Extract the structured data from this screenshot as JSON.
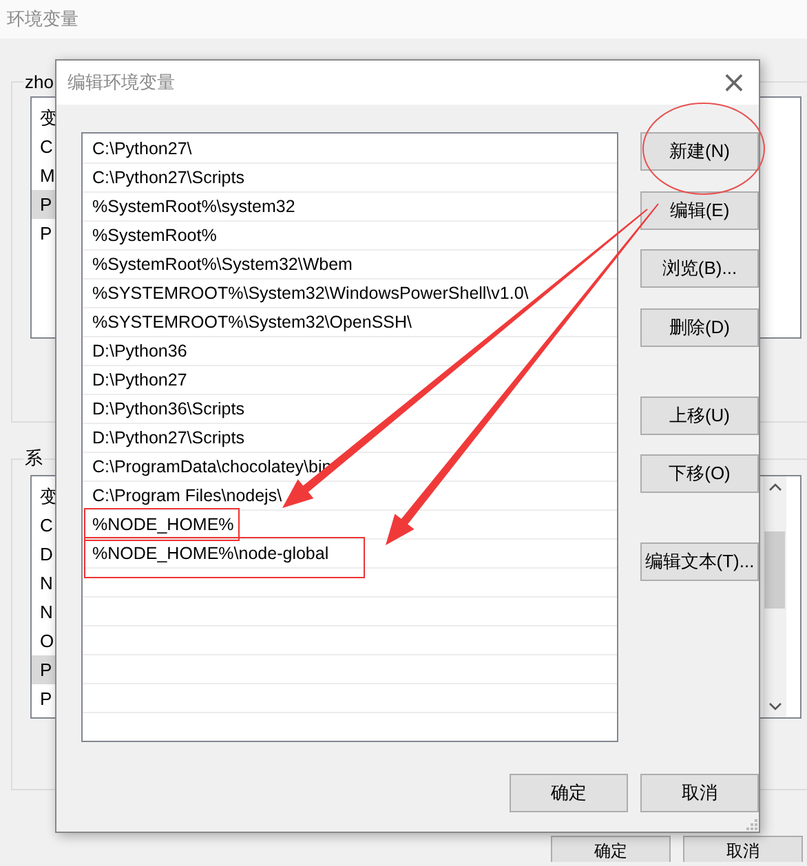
{
  "window": {
    "title": "环境变量"
  },
  "user_variables": {
    "legend": "zho",
    "header": "变",
    "rows": [
      {
        "name": "C",
        "selected": false
      },
      {
        "name": "M",
        "selected": false
      },
      {
        "name": "P",
        "selected": true
      },
      {
        "name": "P",
        "selected": false
      }
    ]
  },
  "system_variables": {
    "legend": "系",
    "header": "变",
    "rows": [
      {
        "name": "C",
        "selected": false
      },
      {
        "name": "D",
        "selected": false
      },
      {
        "name": "N",
        "selected": false
      },
      {
        "name": "N",
        "selected": false
      },
      {
        "name": "O",
        "selected": false
      },
      {
        "name": "P",
        "selected": true
      },
      {
        "name": "P",
        "selected": false
      }
    ]
  },
  "buttons": [
    "确定",
    "取消"
  ],
  "dialog": {
    "title": "编辑环境变量",
    "close": "×",
    "paths": [
      {
        "text": "C:\\Python27\\",
        "highlighted": false
      },
      {
        "text": "C:\\Python27\\Scripts",
        "highlighted": false
      },
      {
        "text": "%SystemRoot%\\system32",
        "highlighted": false
      },
      {
        "text": "%SystemRoot%",
        "highlighted": false
      },
      {
        "text": "%SystemRoot%\\System32\\Wbem",
        "highlighted": false
      },
      {
        "text": "%SYSTEMROOT%\\System32\\WindowsPowerShell\\v1.0\\",
        "highlighted": false
      },
      {
        "text": "%SYSTEMROOT%\\System32\\OpenSSH\\",
        "highlighted": false
      },
      {
        "text": "D:\\Python36",
        "highlighted": false
      },
      {
        "text": "D:\\Python27",
        "highlighted": false
      },
      {
        "text": "D:\\Python36\\Scripts",
        "highlighted": false
      },
      {
        "text": "D:\\Python27\\Scripts",
        "highlighted": false
      },
      {
        "text": "C:\\ProgramData\\chocolatey\\bin",
        "highlighted": false
      },
      {
        "text": "C:\\Program Files\\nodejs\\",
        "highlighted": false
      },
      {
        "text": "%NODE_HOME%",
        "highlighted": true
      },
      {
        "text": "%NODE_HOME%\\node-global",
        "highlighted": true
      }
    ],
    "button_groups": [
      [
        {
          "label": "新建(N)",
          "circled": true
        },
        {
          "label": "编辑(E)",
          "circled": false
        },
        {
          "label": "浏览(B)...",
          "circled": false
        },
        {
          "label": "删除(D)",
          "circled": false
        }
      ],
      [
        {
          "label": "上移(U)",
          "circled": false
        },
        {
          "label": "下移(O)",
          "circled": false
        }
      ],
      [
        {
          "label": "编辑文本(T)...",
          "circled": false
        }
      ]
    ],
    "buttons": [
      "确定",
      "取消"
    ]
  }
}
